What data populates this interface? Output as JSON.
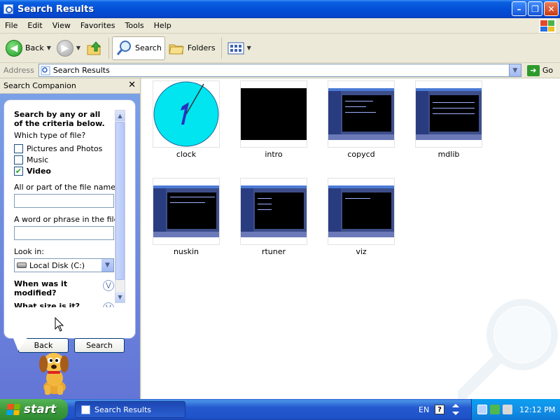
{
  "window": {
    "title": "Search Results"
  },
  "menu": [
    "File",
    "Edit",
    "View",
    "Favorites",
    "Tools",
    "Help"
  ],
  "toolbar": {
    "back": "Back",
    "search": "Search",
    "folders": "Folders"
  },
  "address": {
    "label": "Address",
    "value": "Search Results",
    "go": "Go"
  },
  "companion": {
    "header": "Search Companion",
    "heading": "Search by any or all of the criteria below.",
    "file_type_label": "Which type of file?",
    "file_types": [
      {
        "label": "Pictures and Photos",
        "checked": false
      },
      {
        "label": "Music",
        "checked": false
      },
      {
        "label": "Video",
        "checked": true
      }
    ],
    "name_label": "All or part of the file name:",
    "phrase_label": "A word or phrase in the file:",
    "look_in_label": "Look in:",
    "look_in_value": "Local Disk (C:)",
    "modified_label": "When was it modified?",
    "size_label": "What size is it?",
    "back_button": "Back",
    "search_button": "Search"
  },
  "results": [
    {
      "name": "clock",
      "kind": "clock"
    },
    {
      "name": "intro",
      "kind": "black"
    },
    {
      "name": "copycd",
      "kind": "screen"
    },
    {
      "name": "mdlib",
      "kind": "screen"
    },
    {
      "name": "nuskin",
      "kind": "screen"
    },
    {
      "name": "rtuner",
      "kind": "screen"
    },
    {
      "name": "viz",
      "kind": "screen"
    }
  ],
  "taskbar": {
    "start": "start",
    "task": "Search Results",
    "lang": "EN",
    "time": "12:12 PM"
  },
  "colors": {
    "titlebar": "#0450d8",
    "pane": "#7ba2e7",
    "start": "#3c9a3d",
    "tray": "#0c9ff0"
  }
}
